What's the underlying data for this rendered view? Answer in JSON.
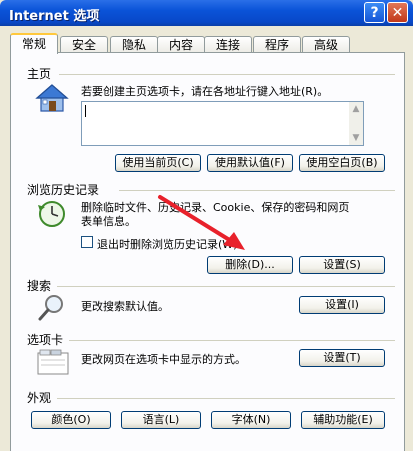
{
  "window": {
    "title": "Internet 选项",
    "help_label": "?",
    "close_label": "✕"
  },
  "tabs": [
    {
      "label": "常规",
      "active": true
    },
    {
      "label": "安全",
      "active": false
    },
    {
      "label": "隐私",
      "active": false
    },
    {
      "label": "内容",
      "active": false
    },
    {
      "label": "连接",
      "active": false
    },
    {
      "label": "程序",
      "active": false
    },
    {
      "label": "高级",
      "active": false
    }
  ],
  "home": {
    "heading": "主页",
    "description": "若要创建主页选项卡，请在各地址行键入地址(R)。",
    "address_value": "",
    "buttons": {
      "use_current": "使用当前页(C)",
      "use_default": "使用默认值(F)",
      "use_blank": "使用空白页(B)"
    },
    "icon": "house-icon"
  },
  "history": {
    "heading": "浏览历史记录",
    "description_line1": "删除临时文件、历史记录、Cookie、保存的密码和网页",
    "description_line2": "表单信息。",
    "checkbox_label": "退出时删除浏览历史记录(W)",
    "checkbox_checked": false,
    "delete_button": "删除(D)...",
    "settings_button": "设置(S)",
    "icon": "history-clock-icon"
  },
  "search": {
    "heading": "搜索",
    "description": "更改搜索默认值。",
    "settings_button": "设置(I)",
    "icon": "magnifier-icon"
  },
  "tabs_section": {
    "heading": "选项卡",
    "description": "更改网页在选项卡中显示的方式。",
    "settings_button": "设置(T)",
    "icon": "tabs-window-icon"
  },
  "appearance": {
    "heading": "外观",
    "buttons": {
      "colors": "颜色(O)",
      "languages": "语言(L)",
      "fonts": "字体(N)",
      "accessibility": "辅助功能(E)"
    }
  },
  "colors": {
    "title_bar": "#0a53d8",
    "tab_highlight": "#ffc83c",
    "annotation_arrow": "#e8212b"
  }
}
